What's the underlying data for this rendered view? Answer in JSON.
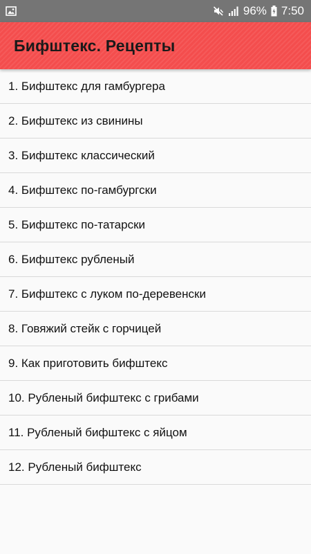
{
  "status_bar": {
    "battery_percent": "96%",
    "time": "7:50",
    "icons": [
      "image-notification-icon",
      "mute-icon",
      "signal-icon",
      "battery-charging-icon"
    ]
  },
  "app_bar": {
    "title": "Бифштекс. Рецепты",
    "color": "#f44d4d"
  },
  "recipes": [
    "1. Бифштекс для гамбургера",
    "2. Бифштекс из свинины",
    "3. Бифштекс классический",
    "4. Бифштекс по-гамбургски",
    "5. Бифштекс по-татарски",
    "6. Бифштекс рубленый",
    "7. Бифштекс с луком по-деревенски",
    "8. Говяжий стейк с горчицей",
    "9. Как приготовить бифштекс",
    "10. Рубленый бифштекс с грибами",
    "11. Рубленый бифштекс с яйцом",
    "12. Рубленый бифштекс"
  ]
}
